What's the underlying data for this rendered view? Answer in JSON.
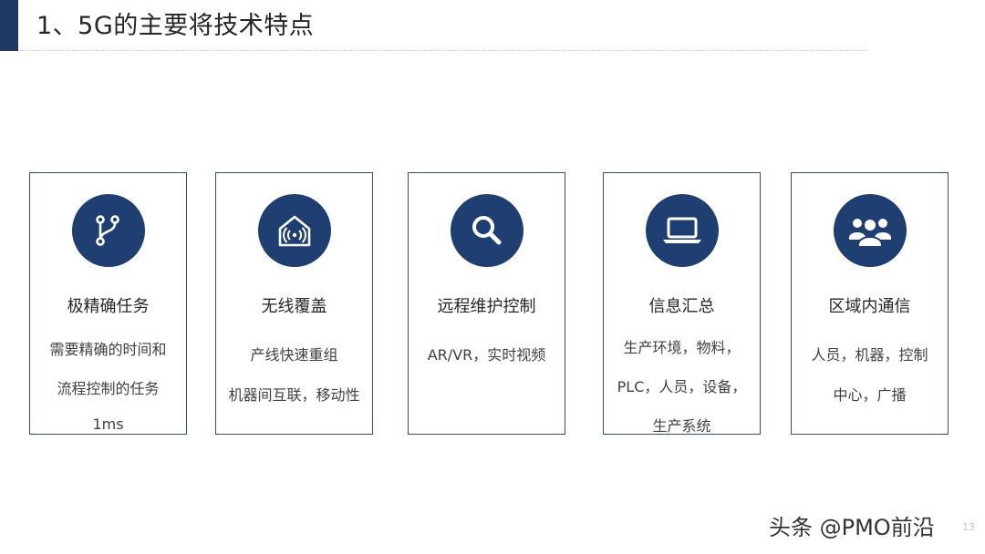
{
  "slide": {
    "title": "1、5G的主要将技术特点"
  },
  "cards": [
    {
      "icon": "git-branch-icon",
      "title": "极精确任务",
      "lines": [
        "需要精确的时间和",
        "流程控制的任务",
        "1ms"
      ]
    },
    {
      "icon": "wifi-house-icon",
      "title": "无线覆盖",
      "lines": [
        "产线快速重组",
        "机器间互联，移动性"
      ]
    },
    {
      "icon": "search-icon",
      "title": "远程维护控制",
      "lines": [
        "AR/VR，实时视频"
      ]
    },
    {
      "icon": "laptop-icon",
      "title": "信息汇总",
      "lines": [
        "生产环境，物料，",
        "PLC，人员，设备，",
        "生产系统"
      ]
    },
    {
      "icon": "users-icon",
      "title": "区域内通信",
      "lines": [
        "人员，机器，控制",
        "中心，广播"
      ]
    }
  ],
  "footer": {
    "watermark": "头条 @PMO前沿",
    "page_number": "13"
  },
  "colors": {
    "accent": "#1f3864",
    "icon_circle": "#1f3f72",
    "card_border": "#2e4e86"
  }
}
